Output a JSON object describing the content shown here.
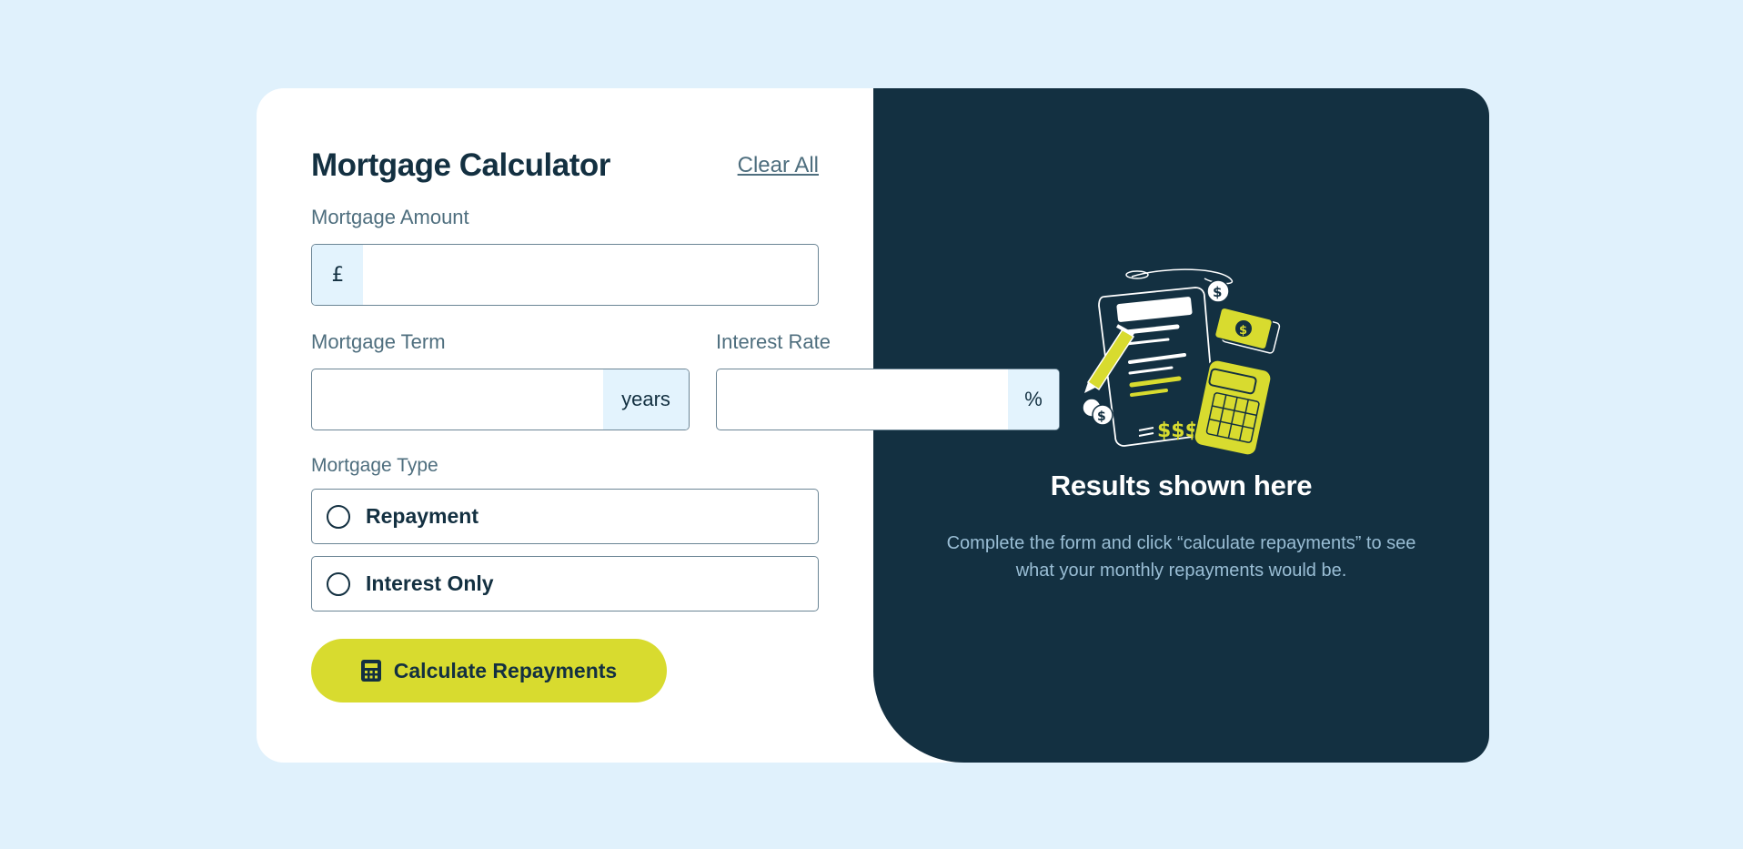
{
  "header": {
    "title": "Mortgage Calculator",
    "clear_label": "Clear All"
  },
  "amount": {
    "label": "Mortgage Amount",
    "prefix": "£",
    "value": ""
  },
  "term": {
    "label": "Mortgage Term",
    "suffix": "years",
    "value": ""
  },
  "rate": {
    "label": "Interest Rate",
    "suffix": "%",
    "value": ""
  },
  "mortgage_type": {
    "label": "Mortgage Type",
    "options": [
      {
        "label": "Repayment",
        "selected": false
      },
      {
        "label": "Interest Only",
        "selected": false
      }
    ]
  },
  "submit": {
    "label": "Calculate Repayments",
    "icon": "calculator-icon"
  },
  "results": {
    "illustration": "empty-results-illustration",
    "title": "Results shown here",
    "description": "Complete the form and click “calculate repayments” to see what your monthly repayments would be."
  },
  "colors": {
    "page_bg": "#e0f1fc",
    "dark": "#133041",
    "lime": "#d8db2f",
    "muted": "#4e6e7e",
    "accent_bg": "#e3f3fd"
  }
}
